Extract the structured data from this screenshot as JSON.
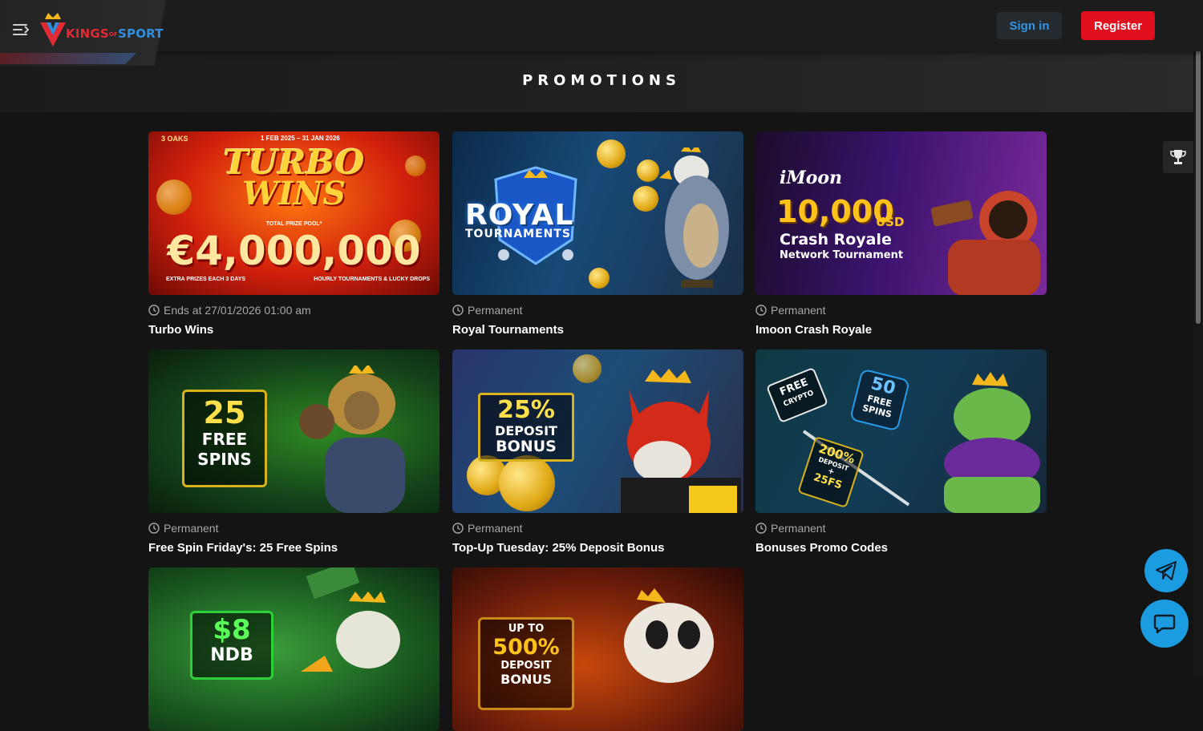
{
  "header": {
    "logo_kings": "KINGS",
    "logo_of": "OF",
    "logo_sport": "SPORT",
    "signin_label": "Sign in",
    "register_label": "Register"
  },
  "page": {
    "title": "PROMOTIONS"
  },
  "promotions": [
    {
      "status": "Ends at 27/01/2026 01:00 am",
      "title": "Turbo Wins",
      "banner": {
        "brand": "3 OAKS",
        "dates": "1 FEB 2025 – 31 JAN 2026",
        "headline1": "TURBO",
        "headline2": "WINS",
        "pool_label": "TOTAL PRIZE POOL*",
        "amount": "€4,000,000",
        "footer_left": "EXTRA PRIZES EACH 3 DAYS",
        "footer_right": "HOURLY TOURNAMENTS & LUCKY DROPS"
      }
    },
    {
      "status": "Permanent",
      "title": "Royal Tournaments",
      "banner": {
        "headline1": "ROYAL",
        "headline2": "TOURNAMENTS"
      }
    },
    {
      "status": "Permanent",
      "title": "Imoon Crash Royale",
      "banner": {
        "brand": "iMoon",
        "amount": "10,000",
        "currency": "USD",
        "headline1": "Crash Royale",
        "headline2": "Network Tournament"
      }
    },
    {
      "status": "Permanent",
      "title": "Free Spin Friday's: 25 Free Spins",
      "banner": {
        "line1": "25",
        "line2": "FREE",
        "line3": "SPINS"
      }
    },
    {
      "status": "Permanent",
      "title": "Top-Up Tuesday: 25% Deposit Bonus",
      "banner": {
        "line1": "25%",
        "line2": "DEPOSIT",
        "line3": "BONUS"
      }
    },
    {
      "status": "Permanent",
      "title": "Bonuses Promo Codes",
      "banner": {
        "tag1_a": "FREE",
        "tag1_b": "CRYPTO",
        "tag2_a": "50",
        "tag2_b": "FREE",
        "tag2_c": "SPINS",
        "tag3_a": "200%",
        "tag3_b": "DEPOSIT",
        "tag3_c": "+",
        "tag3_d": "25FS"
      }
    },
    {
      "banner": {
        "line1": "$8",
        "line2": "NDB"
      }
    },
    {
      "banner": {
        "line1": "UP TO",
        "line2": "500%",
        "line3": "DEPOSIT",
        "line4": "BONUS"
      }
    }
  ],
  "colors": {
    "accent_red": "#e0101e",
    "accent_blue": "#1b9be0",
    "link_blue": "#2e95e6"
  },
  "icons": {
    "menu": "menu-collapse-icon",
    "trophy": "trophy-icon",
    "clock": "clock-icon",
    "telegram": "telegram-icon",
    "chat": "chat-icon"
  }
}
